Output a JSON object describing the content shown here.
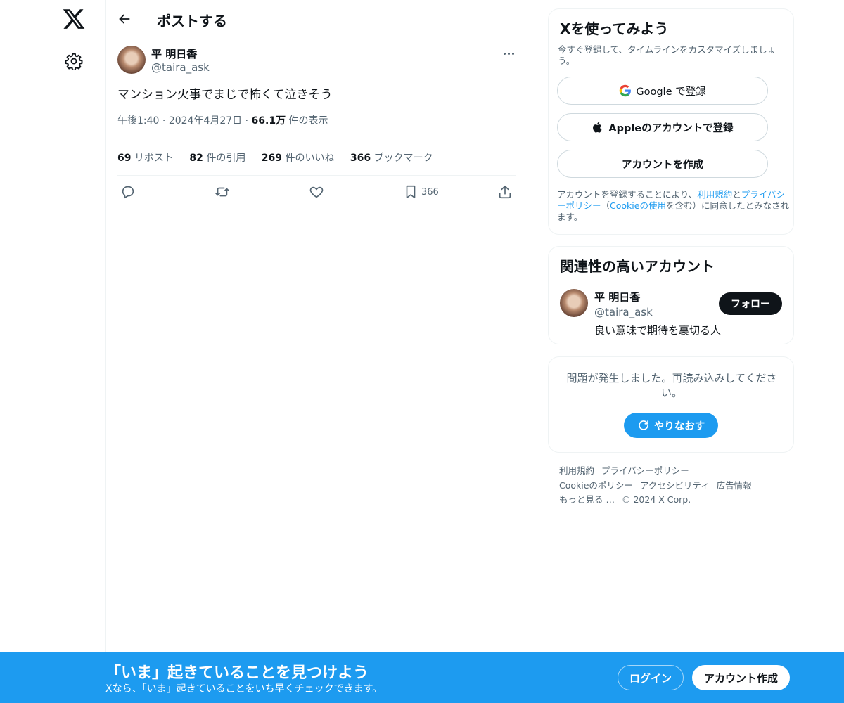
{
  "colors": {
    "accent": "#1d9bf0",
    "text": "#0f1419",
    "muted": "#536471",
    "border": "#eff3f4"
  },
  "nav": {
    "logo_icon": "x-logo-icon",
    "settings_icon": "gear-icon"
  },
  "header": {
    "title": "ポストする",
    "back_icon": "arrow-left-icon"
  },
  "post": {
    "author_name": "平 明日香",
    "author_handle": "@taira_ask",
    "text": "マンション火事でまじで怖くて泣きそう",
    "time": "午後1:40",
    "date": "2024年4月27日",
    "views_count": "66.1万",
    "views_label": "件の表示",
    "stats": {
      "reposts_count": "69",
      "reposts_label": "リポスト",
      "quotes_count": "82",
      "quotes_label": "件の引用",
      "likes_count": "269",
      "likes_label": "件のいいね",
      "bookmarks_count": "366",
      "bookmarks_label": "ブックマーク"
    },
    "actions": {
      "bookmark_count": "366"
    }
  },
  "signup_card": {
    "title": "Xを使ってみよう",
    "subtitle": "今すぐ登録して、タイムラインをカスタマイズしましょう。",
    "google_label": "Google で登録",
    "apple_label": "Appleのアカウントで登録",
    "create_label": "アカウントを作成",
    "legal_prefix": "アカウントを登録することにより、",
    "legal_terms": "利用規約",
    "legal_and": "と",
    "legal_privacy": "プライバシーポリシー",
    "legal_paren_open": "（",
    "legal_cookie": "Cookieの使用",
    "legal_suffix": "を含む）に同意したとみなされます。"
  },
  "related": {
    "title": "関連性の高いアカウント",
    "name": "平 明日香",
    "handle": "@taira_ask",
    "bio": "良い意味で期待を裏切る人",
    "follow_label": "フォロー"
  },
  "error_card": {
    "message": "問題が発生しました。再読み込みしてください。",
    "retry_label": "やりなおす"
  },
  "footer": {
    "terms": "利用規約",
    "privacy": "プライバシーポリシー",
    "cookie": "Cookieのポリシー",
    "accessibility": "アクセシビリティ",
    "ads": "広告情報",
    "more": "もっと見る …",
    "copyright": "© 2024 X Corp."
  },
  "banner": {
    "title": "「いま」起きていることを見つけよう",
    "subtitle": "Xなら、「いま」起きていることをいち早くチェックできます。",
    "login_label": "ログイン",
    "signup_label": "アカウント作成"
  }
}
